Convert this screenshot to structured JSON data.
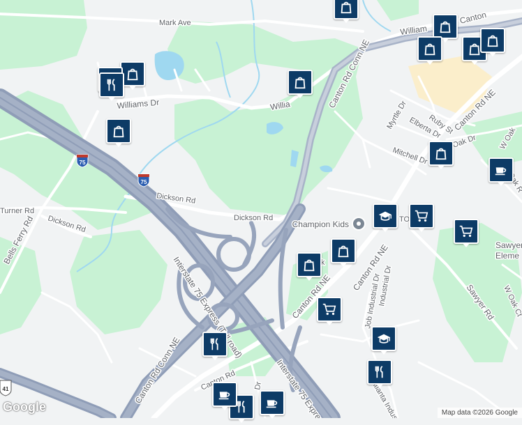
{
  "streets": {
    "mark_ave": "Mark Ave",
    "williams_dr": "Williams Dr",
    "william_frag_top": "William",
    "willia_frag": "Willia",
    "canton_conn_ne_top": "Canton Rd Conn NE",
    "canton_rd_ne_top": "Canton Rd NE",
    "canton_frag_top": "Canton",
    "myrtle_dr": "Myrtle Dr",
    "ruby_st": "Ruby St",
    "elberta_dr": "Elberta Dr",
    "mitchell_dr": "Mitchell Dr",
    "oak_dr": "Oak Dr",
    "w_oak_frag": "W Oak",
    "oak_r_frag": "Oak R",
    "dickson_rd_1": "Dickson Rd",
    "dickson_rd_2": "Dickson Rd",
    "dickson_rd_3": "Dickson Rd",
    "dick_frag": "Dick",
    "turner_rd": "Turner Rd",
    "bells_ferry_rd": "Bells Ferry Rd",
    "i75_express": "Interstate 75 Express (Toll road)",
    "i75_express_2": "Interstate 75 Express",
    "canton_rd_ne_mid": "Canton Rd NE",
    "canton_rd_ne_mid2": "Canton Rd NE",
    "canton_conn_ne_low": "Canton Rd Conn NE",
    "canton_rd_low": "Canton Rd",
    "industrial_dr": "Industrial Dr",
    "job_industrial_dr": "Job Industrial Dr",
    "atlanta_industrial": "Atlanta Indust",
    "sawyer_rd": "Sawyer Rd",
    "w_oak_ct": "W Oak Ct",
    "to_frag": "TO",
    "dr_frag": "Dr"
  },
  "shields": {
    "i75_a": "75",
    "i75_b": "75",
    "us41": "41"
  },
  "pois": {
    "champion_kids": "Champion Kids",
    "sawyer_elem_1": "Sawyer",
    "sawyer_elem_2": "Eleme"
  },
  "branding": {
    "logo": "Google",
    "credit": "Map data ©2026 Google"
  },
  "colors": {
    "land": "#f1f3f4",
    "park": "#c8f2d4",
    "water": "#9fd8f0",
    "highway": "#8f9db7",
    "road": "#ffffff",
    "commercial": "#fbeecb",
    "marker": "#0d3b66"
  },
  "markers": [
    {
      "icon": "shopping-bag-icon"
    },
    {
      "icon": "shopping-bag-icon"
    },
    {
      "icon": "shopping-bag-icon"
    },
    {
      "icon": "shopping-bag-icon"
    },
    {
      "icon": "shopping-bag-icon"
    },
    {
      "icon": "shopping-bag-icon"
    },
    {
      "icon": "shopping-bag-icon"
    },
    {
      "icon": "shopping-bag-icon"
    },
    {
      "icon": "shopping-bag-icon"
    },
    {
      "icon": "shopping-bag-icon"
    },
    {
      "icon": "shopping-bag-icon"
    },
    {
      "icon": "restaurant-icon"
    },
    {
      "icon": "restaurant-icon"
    },
    {
      "icon": "restaurant-icon"
    },
    {
      "icon": "restaurant-icon"
    },
    {
      "icon": "restaurant-icon"
    },
    {
      "icon": "cafe-icon"
    },
    {
      "icon": "cafe-icon"
    },
    {
      "icon": "cafe-icon"
    },
    {
      "icon": "school-icon"
    },
    {
      "icon": "school-icon"
    },
    {
      "icon": "shopping-cart-icon"
    },
    {
      "icon": "shopping-cart-icon"
    },
    {
      "icon": "shopping-cart-icon"
    }
  ]
}
